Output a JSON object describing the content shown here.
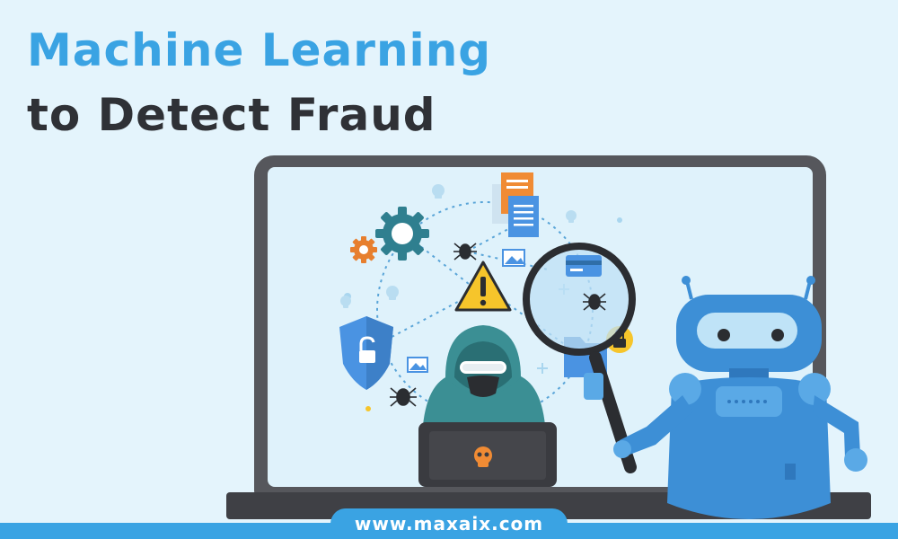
{
  "headline": {
    "line1": "Machine Learning",
    "line2": "to Detect Fraud"
  },
  "footer": {
    "url": "www.maxaix.com"
  },
  "icons": [
    "gear-icon",
    "document-icon",
    "skull-icon",
    "bug-icon",
    "image-icon",
    "warning-icon",
    "shield-unlock-icon",
    "credit-card-icon",
    "folder-icon",
    "lock-icon",
    "magnifier-icon",
    "hacker-figure",
    "robot-figure",
    "laptop-icon"
  ],
  "colors": {
    "background": "#e4f4fc",
    "title_primary": "#3aa3e3",
    "title_secondary": "#2f3136",
    "monitor_frame": "#56575c",
    "screen": "#dff2fb",
    "accent_blue": "#3e9fdf",
    "robot": "#3d8fd6",
    "warning": "#f6c52b",
    "gear_teal": "#2f7f8f",
    "gear_orange": "#e77f2e",
    "hoodie": "#3b8f94"
  }
}
